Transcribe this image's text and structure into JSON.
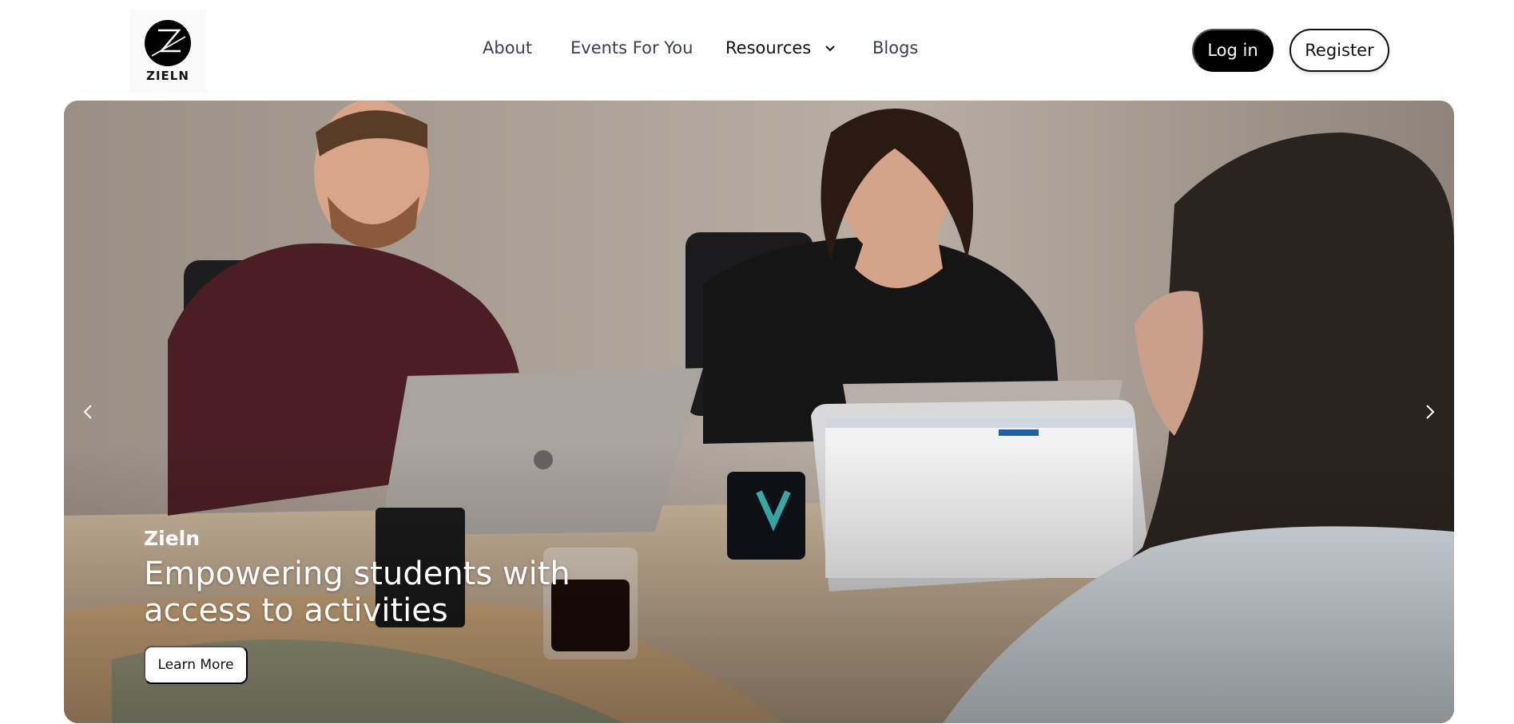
{
  "brand": {
    "logo_text": "ZIELN",
    "logo_icon": "zieln-logo-icon"
  },
  "nav": {
    "items": [
      {
        "label": "About"
      },
      {
        "label": "Events For You"
      },
      {
        "label": "Resources",
        "icon": "chevron-down-icon"
      },
      {
        "label": "Blogs"
      }
    ]
  },
  "auth": {
    "login_label": "Log in",
    "register_label": "Register"
  },
  "hero": {
    "brand": "Zieln",
    "headline": "Empowering students with access to activities",
    "cta_label": "Learn More",
    "prev_icon": "chevron-left-icon",
    "next_icon": "chevron-right-icon"
  },
  "colors": {
    "primary": "#000000",
    "background": "#ffffff",
    "nav_text": "#3a3f4a"
  }
}
